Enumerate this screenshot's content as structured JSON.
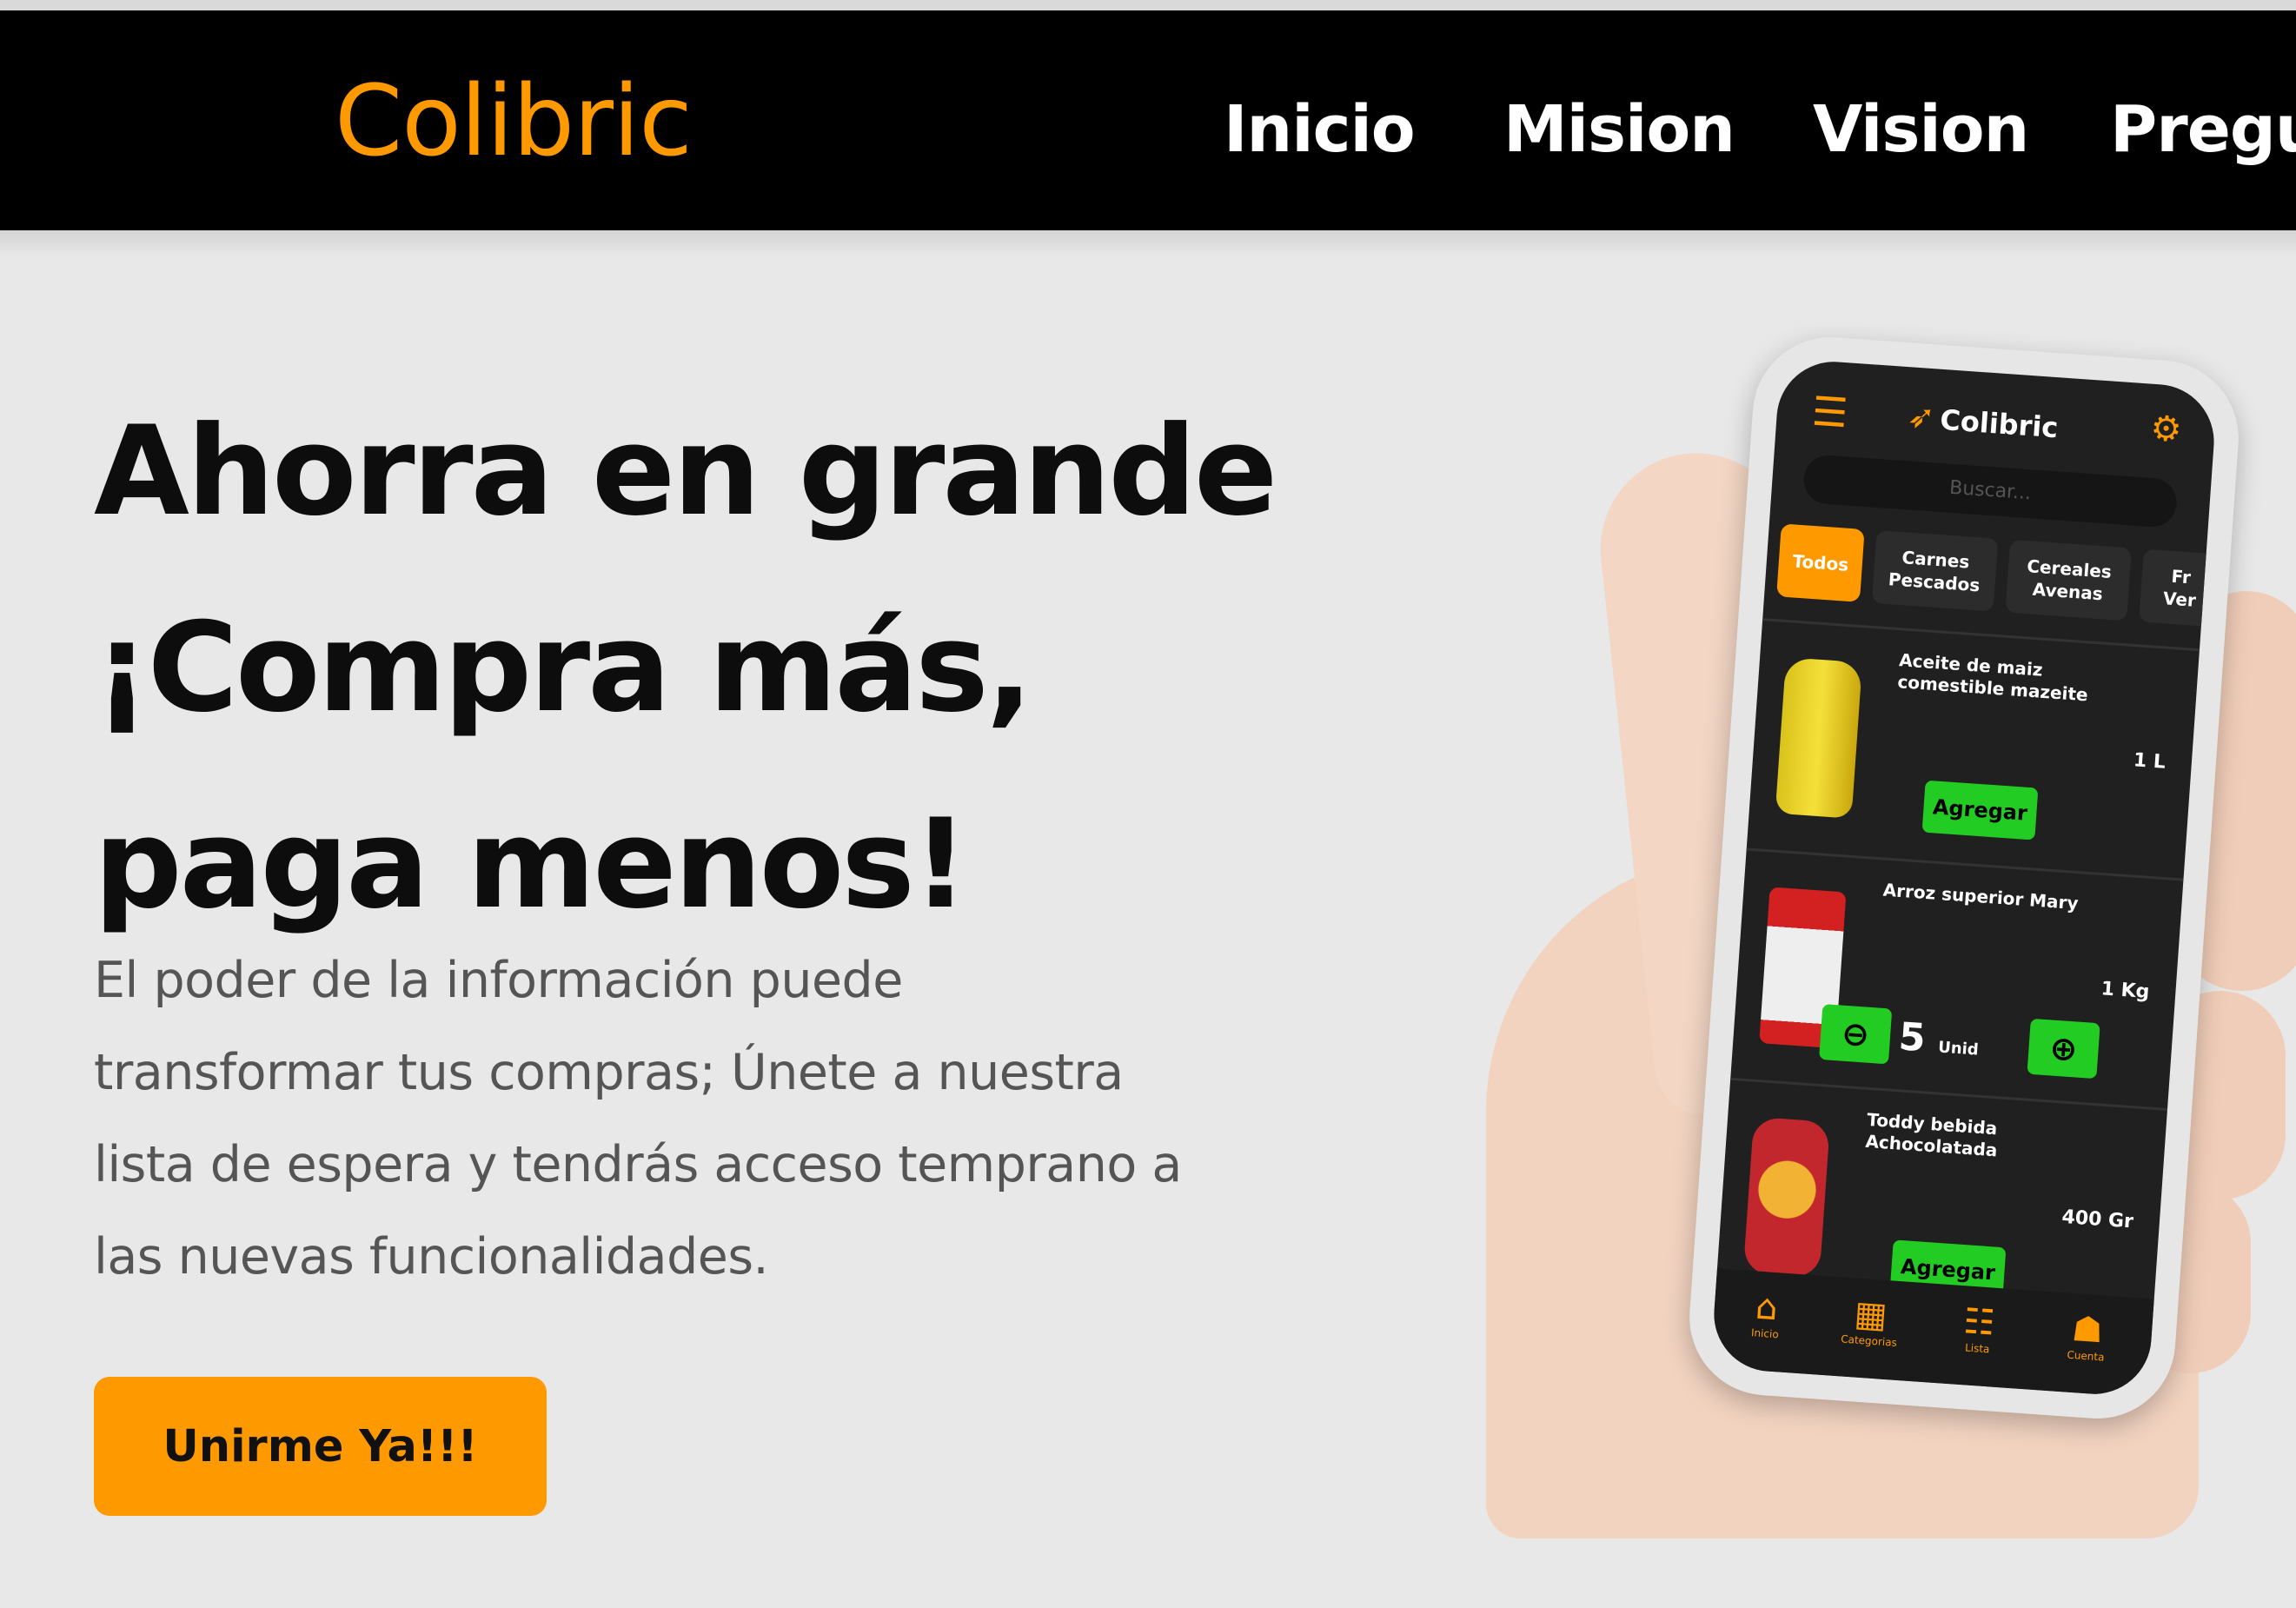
{
  "navbar": {
    "brand": "Colibric",
    "links": [
      "Inicio",
      "Mision",
      "Vision",
      "Pregu"
    ]
  },
  "hero": {
    "title_lines": [
      "Ahorra en grande",
      "¡Compra más,",
      "paga menos!"
    ],
    "description_lines": [
      "El poder de la información puede",
      "transformar tus compras; Únete a nuestra",
      "lista de espera y tendrás acceso temprano a",
      "las nuevas funcionalidades."
    ],
    "cta_label": "Unirme Ya!!!"
  },
  "phone_app": {
    "brand": "Colibric",
    "search_placeholder": "Buscar...",
    "chips": [
      {
        "line1": "Todos",
        "line2": ""
      },
      {
        "line1": "Carnes",
        "line2": "Pescados"
      },
      {
        "line1": "Cereales",
        "line2": "Avenas"
      },
      {
        "line1": "Fr",
        "line2": "Ver"
      }
    ],
    "products": [
      {
        "name": "Aceite de maiz comestible mazeite",
        "size": "1 L",
        "action": "Agregar"
      },
      {
        "name": "Arroz superior Mary",
        "size": "1 Kg",
        "quantity": "5",
        "unit": "Unid"
      },
      {
        "name": "Toddy bebida Achocolatada",
        "size": "400 Gr",
        "action": "Agregar"
      }
    ],
    "bottom_nav": [
      "Inicio",
      "Categorias",
      "Lista",
      "Cuenta"
    ]
  },
  "colors": {
    "accent": "#ff9900",
    "navbar_bg": "#000000",
    "page_bg": "#e8e8e8",
    "app_bg": "#202020",
    "app_button": "#22cc22"
  }
}
